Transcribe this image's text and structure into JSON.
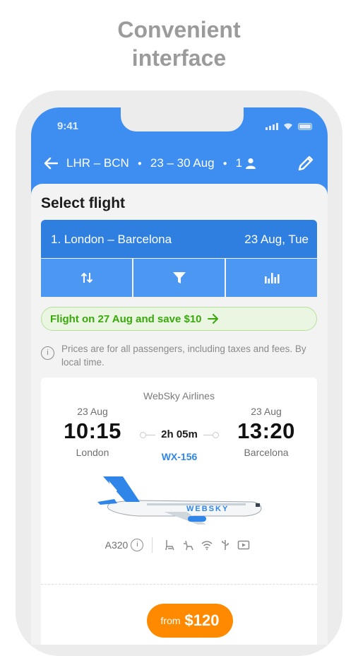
{
  "headline": {
    "line1": "Convenient",
    "line2": "interface"
  },
  "status": {
    "time": "9:41"
  },
  "nav": {
    "route": "LHR – BCN",
    "dates": "23 – 30 Aug",
    "passengers": "1"
  },
  "page": {
    "title": "Select flight"
  },
  "leg": {
    "name": "1. London – Barcelona",
    "date": "23 Aug, Tue"
  },
  "promo": {
    "text": "Flight on 27 Aug and save $10"
  },
  "info": {
    "text": "Prices are for all passengers, including taxes and fees. By local time."
  },
  "flight": {
    "airline": "WebSky Airlines",
    "depart_date": "23 Aug",
    "depart_time": "10:15",
    "depart_city": "London",
    "arrive_date": "23 Aug",
    "arrive_time": "13:20",
    "arrive_city": "Barcelona",
    "duration": "2h 05m",
    "number": "WX-156",
    "aircraft": "A320",
    "livery": "WEBSKY",
    "price_prefix": "from",
    "price": "$120"
  },
  "colors": {
    "brand_blue": "#3d8ef0",
    "accent_orange": "#ff8a00",
    "promo_green": "#3aa70d"
  }
}
